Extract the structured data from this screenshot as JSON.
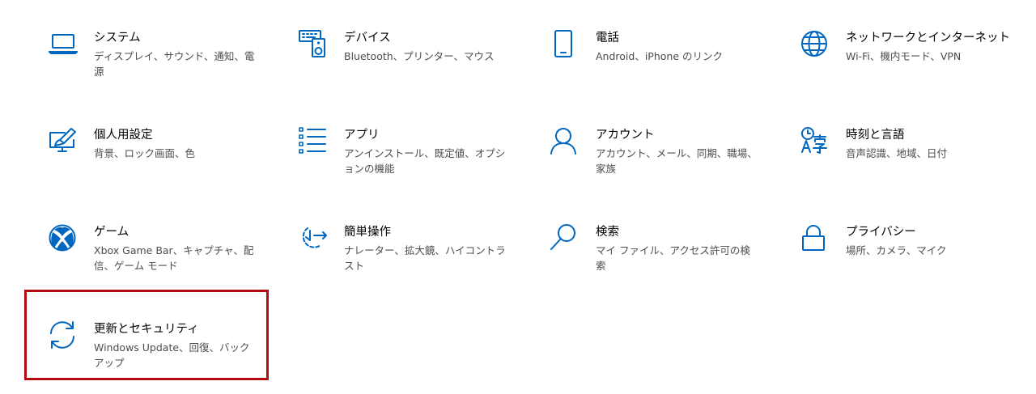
{
  "accent_color": "#0067c0",
  "highlight_color": "#b30b11",
  "tiles": [
    {
      "title": "システム",
      "desc": "ディスプレイ、サウンド、通知、電源",
      "icon": "laptop-icon"
    },
    {
      "title": "デバイス",
      "desc": "Bluetooth、プリンター、マウス",
      "icon": "keyboard-speaker-icon"
    },
    {
      "title": "電話",
      "desc": "Android、iPhone のリンク",
      "icon": "phone-icon"
    },
    {
      "title": "ネットワークとインターネット",
      "desc": "Wi-Fi、機内モード、VPN",
      "icon": "globe-icon"
    },
    {
      "title": "個人用設定",
      "desc": "背景、ロック画面、色",
      "icon": "paintbrush-monitor-icon"
    },
    {
      "title": "アプリ",
      "desc": "アンインストール、既定値、オプションの機能",
      "icon": "apps-list-icon"
    },
    {
      "title": "アカウント",
      "desc": "アカウント、メール、同期、職場、家族",
      "icon": "person-icon"
    },
    {
      "title": "時刻と言語",
      "desc": "音声認識、地域、日付",
      "icon": "time-language-icon"
    },
    {
      "title": "ゲーム",
      "desc": "Xbox Game Bar、キャプチャ、配信、ゲーム モード",
      "icon": "xbox-icon"
    },
    {
      "title": "簡単操作",
      "desc": "ナレーター、拡大鏡、ハイコントラスト",
      "icon": "ease-of-access-icon"
    },
    {
      "title": "検索",
      "desc": "マイ ファイル、アクセス許可の検索",
      "icon": "search-icon"
    },
    {
      "title": "プライバシー",
      "desc": "場所、カメラ、マイク",
      "icon": "lock-icon"
    },
    {
      "title": "更新とセキュリティ",
      "desc": "Windows Update、回復、バックアップ",
      "icon": "sync-icon",
      "selected": true
    }
  ]
}
